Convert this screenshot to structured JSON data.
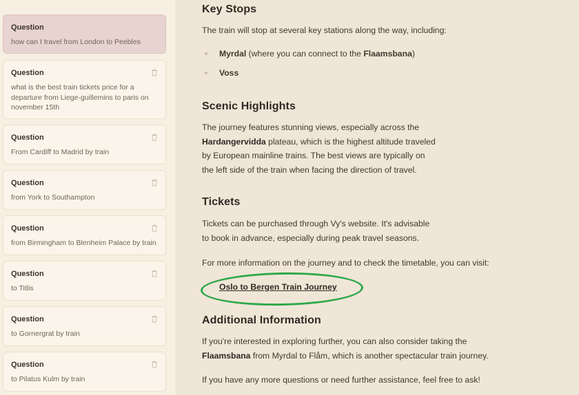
{
  "sidebar": {
    "items": [
      {
        "title": "Question",
        "text": "how can I travel from London to Peebles",
        "active": true
      },
      {
        "title": "Question",
        "text": "what is the best train tickets price for a departure from Liege-guillemins to paris on november 15th"
      },
      {
        "title": "Question",
        "text": "From Cardiff to Madrid by train"
      },
      {
        "title": "Question",
        "text": "from York to Southampton"
      },
      {
        "title": "Question",
        "text": "from Birmingham to Blenheim Palace by train"
      },
      {
        "title": "Question",
        "text": "to Titlis"
      },
      {
        "title": "Question",
        "text": "to Gornergrat by train"
      },
      {
        "title": "Question",
        "text": "to Pilatus Kulm by train"
      }
    ]
  },
  "main": {
    "key_stops": {
      "heading": "Key Stops",
      "intro": "The train will stop at several key stations along the way, including:",
      "stop1_name": "Myrdal",
      "stop1_note_a": " (where you can connect to the ",
      "stop1_connection": "Flaamsbana",
      "stop1_note_b": ")",
      "stop2_name": "Voss"
    },
    "scenic": {
      "heading": "Scenic Highlights",
      "line1": "The journey features stunning views, especially across the",
      "line2_bold": "Hardangervidda",
      "line2_rest": " plateau, which is the highest altitude traveled",
      "line3": "by European mainline trains. The best views are typically on",
      "line4": "the left side of the train when facing the direction of travel."
    },
    "tickets": {
      "heading": "Tickets",
      "line1": "Tickets can be purchased through Vy's website. It's advisable",
      "line2": "to book in advance, especially during peak travel seasons.",
      "more_info": "For more information on the journey and to check the timetable, you can visit:",
      "link_label": "Oslo to Bergen Train Journey"
    },
    "additional": {
      "heading": "Additional Information",
      "line1": "If you're interested in exploring further, you can also consider taking the",
      "line2_bold": "Flaamsbana",
      "line2_rest": " from Myrdal to Flåm, which is another spectacular train journey.",
      "closing": "If you have any more questions or need further assistance, feel free to ask!"
    }
  },
  "colors": {
    "highlight_ring": "#2fa84a",
    "active_card": "#e7d3d0",
    "page_background": "#f0e6d7"
  }
}
